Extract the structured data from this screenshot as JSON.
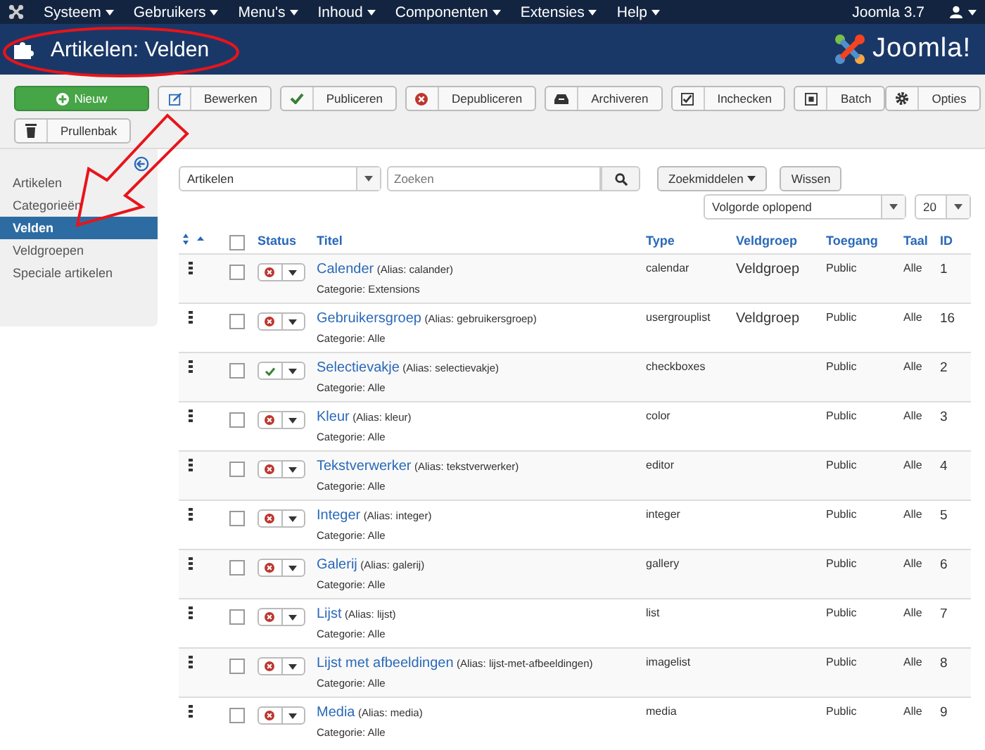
{
  "navbar": {
    "menus": [
      {
        "label": "Systeem"
      },
      {
        "label": "Gebruikers"
      },
      {
        "label": "Menu's"
      },
      {
        "label": "Inhoud"
      },
      {
        "label": "Componenten"
      },
      {
        "label": "Extensies"
      },
      {
        "label": "Help"
      }
    ],
    "version": "Joomla 3.7"
  },
  "header": {
    "title": "Artikelen: Velden",
    "logo_text": "Joomla!"
  },
  "toolbar": {
    "rows": [
      [
        {
          "label": "Nieuw",
          "kind": "new"
        },
        {
          "label": "Bewerken",
          "kind": "edit"
        },
        {
          "label": "Publiceren",
          "kind": "publish"
        },
        {
          "label": "Depubliceren",
          "kind": "unpublish"
        },
        {
          "label": "Archiveren",
          "kind": "archive"
        },
        {
          "label": "Inchecken",
          "kind": "checkin"
        },
        {
          "label": "Batch",
          "kind": "batch"
        }
      ],
      [
        {
          "label": "Prullenbak",
          "kind": "trash"
        }
      ]
    ],
    "options": "Opties"
  },
  "sidebar": {
    "items": [
      {
        "label": "Artikelen",
        "selected": false
      },
      {
        "label": "Categorieën",
        "selected": false
      },
      {
        "label": "Velden",
        "selected": true
      },
      {
        "label": "Veldgroepen",
        "selected": false
      },
      {
        "label": "Speciale artikelen",
        "selected": false
      }
    ]
  },
  "filters": {
    "context": "Artikelen",
    "search": {
      "placeholder": "Zoeken"
    },
    "search_tools": "Zoekmiddelen",
    "clear": "Wissen",
    "ordering": "Volgorde oplopend",
    "limit": "20"
  },
  "table": {
    "all_checked": false,
    "columns": [
      "Status",
      "Titel",
      "Type",
      "Veldgroep",
      "Toegang",
      "Taal",
      "ID"
    ],
    "rows": [
      {
        "title": "Calender",
        "alias": "(Alias: calander)",
        "category": "Categorie: Extensions",
        "published": false,
        "checked": false,
        "type": "calendar",
        "group": "Veldgroep",
        "access": "Public",
        "language": "Alle",
        "id": "1"
      },
      {
        "title": "Gebruikersgroep",
        "alias": "(Alias: gebruikersgroep)",
        "category": "Categorie: Alle",
        "published": false,
        "checked": false,
        "type": "usergrouplist",
        "group": "Veldgroep",
        "access": "Public",
        "language": "Alle",
        "id": "16"
      },
      {
        "title": "Selectievakje",
        "alias": "(Alias: selectievakje)",
        "category": "Categorie: Alle",
        "published": true,
        "checked": false,
        "type": "checkboxes",
        "access": "Public",
        "language": "Alle",
        "id": "2"
      },
      {
        "title": "Kleur",
        "alias": "(Alias: kleur)",
        "category": "Categorie: Alle",
        "published": false,
        "checked": false,
        "type": "color",
        "access": "Public",
        "language": "Alle",
        "id": "3"
      },
      {
        "title": "Tekstverwerker",
        "alias": "(Alias: tekstverwerker)",
        "category": "Categorie: Alle",
        "published": false,
        "checked": false,
        "type": "editor",
        "access": "Public",
        "language": "Alle",
        "id": "4"
      },
      {
        "title": "Integer",
        "alias": "(Alias: integer)",
        "category": "Categorie: Alle",
        "published": false,
        "checked": false,
        "type": "integer",
        "access": "Public",
        "language": "Alle",
        "id": "5"
      },
      {
        "title": "Galerij",
        "alias": "(Alias: galerij)",
        "category": "Categorie: Alle",
        "published": false,
        "checked": false,
        "type": "gallery",
        "access": "Public",
        "language": "Alle",
        "id": "6"
      },
      {
        "title": "Lijst",
        "alias": "(Alias: lijst)",
        "category": "Categorie: Alle",
        "published": false,
        "checked": false,
        "type": "list",
        "access": "Public",
        "language": "Alle",
        "id": "7"
      },
      {
        "title": "Lijst met afbeeldingen",
        "alias": "(Alias: lijst-met-afbeeldingen)",
        "category": "Categorie: Alle",
        "published": false,
        "checked": false,
        "type": "imagelist",
        "access": "Public",
        "language": "Alle",
        "id": "8"
      },
      {
        "title": "Media",
        "alias": "(Alias: media)",
        "category": "Categorie: Alle",
        "published": false,
        "checked": false,
        "type": "media",
        "access": "Public",
        "language": "Alle",
        "id": "9"
      }
    ]
  }
}
